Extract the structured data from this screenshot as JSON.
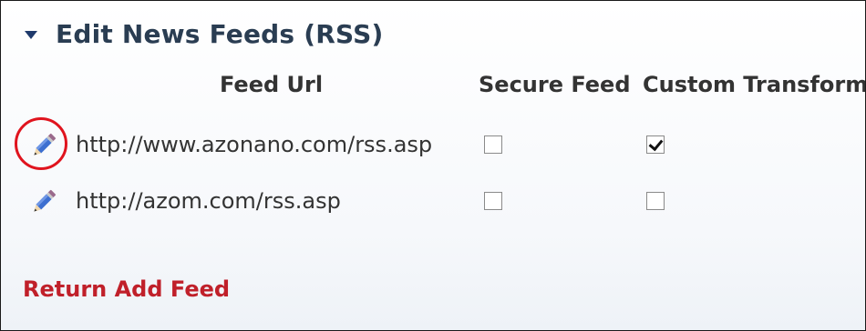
{
  "section": {
    "title": "Edit News Feeds (RSS)",
    "collapse_icon": "triangle-down-icon"
  },
  "table": {
    "headers": {
      "feed_url": "Feed Url",
      "secure_feed": "Secure Feed",
      "custom_transform": "Custom Transform"
    },
    "rows": [
      {
        "url": "http://www.azonano.com/rss.asp",
        "secure_feed": false,
        "custom_transform": true,
        "edit_icon": "pencil-icon",
        "highlighted": true
      },
      {
        "url": "http://azom.com/rss.asp",
        "secure_feed": false,
        "custom_transform": false,
        "edit_icon": "pencil-icon",
        "highlighted": false
      }
    ]
  },
  "footer": {
    "return_label": "Return",
    "add_feed_label": "Add Feed"
  },
  "colors": {
    "title": "#2a3d52",
    "link_red": "#c0202a",
    "highlight_ring": "#e0141e",
    "pencil_blue": "#3d6fd0"
  }
}
